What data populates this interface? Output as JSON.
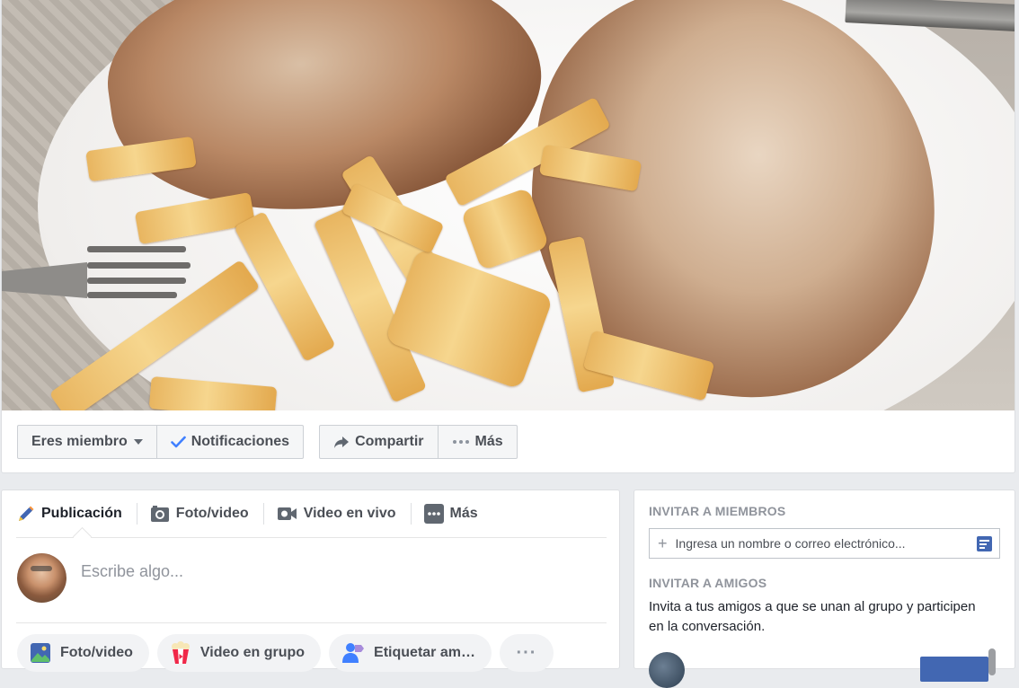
{
  "cover": {
    "photo_alt": "",
    "actions": {
      "member_label": "Eres miembro",
      "notifications_label": "Notificaciones",
      "share_label": "Compartir",
      "more_label": "Más"
    }
  },
  "composer": {
    "tabs": [
      {
        "label": "Publicación",
        "icon": "pencil-icon"
      },
      {
        "label": "Foto/video",
        "icon": "camera-icon"
      },
      {
        "label": "Video en vivo",
        "icon": "video-camera-icon"
      },
      {
        "label": "Más",
        "icon": "more-square-icon"
      }
    ],
    "placeholder": "Escribe algo...",
    "pills": [
      {
        "label": "Foto/video",
        "icon": "photo-icon"
      },
      {
        "label": "Video en grupo",
        "icon": "popcorn-icon"
      },
      {
        "label": "Etiquetar am…",
        "icon": "tag-person-icon"
      }
    ],
    "more_pill": "···"
  },
  "invite": {
    "members_heading": "INVITAR A MIEMBROS",
    "input_placeholder": "Ingresa un nombre o correo electrónico...",
    "friends_heading": "INVITAR A AMIGOS",
    "friends_text": "Invita a tus amigos a que se unan al grupo y participen en la conversación."
  },
  "colors": {
    "page_bg": "#e9ebee",
    "brand_blue": "#4267b2",
    "check_blue": "#4080ff",
    "muted_text": "#90949c"
  }
}
